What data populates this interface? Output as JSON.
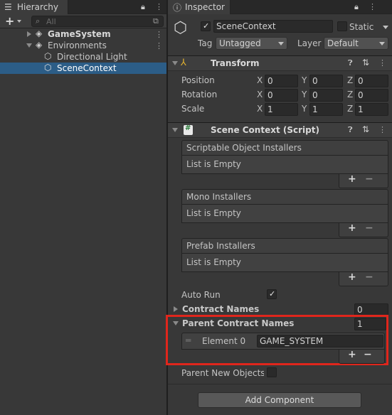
{
  "hierarchy": {
    "tab_label": "Hierarchy",
    "search_placeholder": "All",
    "items": [
      {
        "label": "GameSystem"
      },
      {
        "label": "Environments"
      },
      {
        "label": "Directional Light"
      },
      {
        "label": "SceneContext"
      }
    ]
  },
  "inspector": {
    "tab_label": "Inspector",
    "object_name": "SceneContext",
    "static_label": "Static",
    "tag_label": "Tag",
    "tag_value": "Untagged",
    "layer_label": "Layer",
    "layer_value": "Default",
    "transform": {
      "title": "Transform",
      "rows": [
        {
          "label": "Position",
          "x": "0",
          "y": "0",
          "z": "0"
        },
        {
          "label": "Rotation",
          "x": "0",
          "y": "0",
          "z": "0"
        },
        {
          "label": "Scale",
          "x": "1",
          "y": "1",
          "z": "1"
        }
      ],
      "axis_x": "X",
      "axis_y": "Y",
      "axis_z": "Z"
    },
    "scene_context": {
      "title": "Scene Context (Script)",
      "lists": [
        {
          "header": "Scriptable Object Installers",
          "empty": "List is Empty"
        },
        {
          "header": "Mono Installers",
          "empty": "List is Empty"
        },
        {
          "header": "Prefab Installers",
          "empty": "List is Empty"
        }
      ],
      "auto_run_label": "Auto Run",
      "auto_run_checked": true,
      "contract_names_label": "Contract Names",
      "contract_names_count": "0",
      "parent_contract_names_label": "Parent Contract Names",
      "parent_contract_names_count": "1",
      "element0_label": "Element 0",
      "element0_value": "GAME_SYSTEM",
      "parent_new_objects_label": "Parent New Objects U"
    },
    "add_component": "Add Component"
  },
  "colors": {
    "selection": "#2c5d87",
    "highlight": "#e0261c",
    "background": "#383838"
  }
}
